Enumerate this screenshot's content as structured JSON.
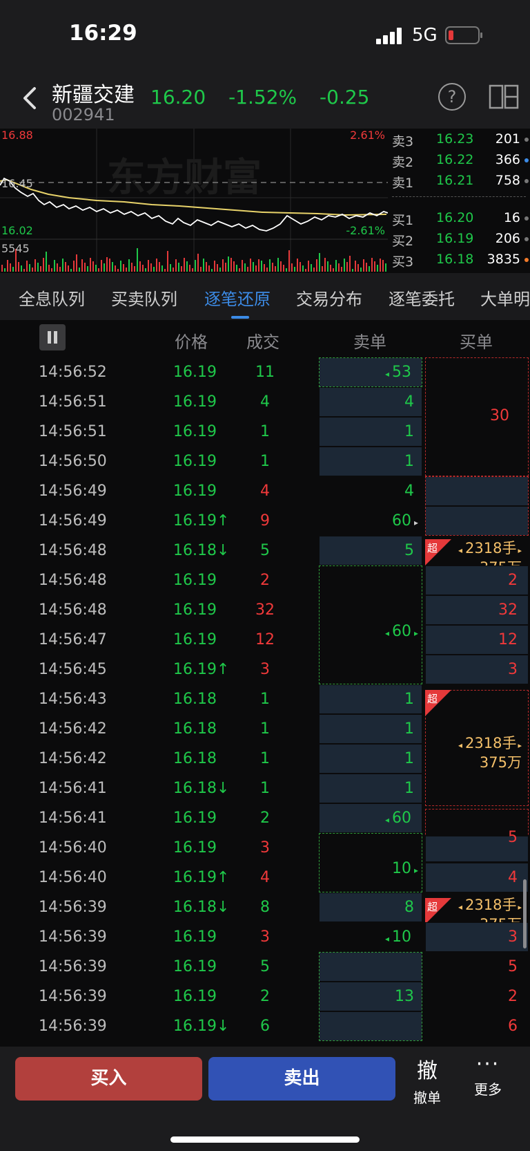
{
  "status": {
    "time": "16:29",
    "network": "5G"
  },
  "header": {
    "name": "新疆交建",
    "code": "002941",
    "price": "16.20",
    "pct": "-1.52%",
    "change": "-0.25",
    "help": "?"
  },
  "chart": {
    "high": "16.88",
    "high_pct": "2.61%",
    "mid": "16.45",
    "low": "16.02",
    "low_pct": "-2.61%",
    "volume": "5545",
    "watermark": "东方财富"
  },
  "book": {
    "sells": [
      {
        "label": "卖3",
        "price": "16.23",
        "vol": "201",
        "dot": "#777777"
      },
      {
        "label": "卖2",
        "price": "16.22",
        "vol": "366",
        "dot": "#3c8be6"
      },
      {
        "label": "卖1",
        "price": "16.21",
        "vol": "758",
        "dot": "#777777"
      }
    ],
    "buys": [
      {
        "label": "买1",
        "price": "16.20",
        "vol": "16",
        "dot": "#777777"
      },
      {
        "label": "买2",
        "price": "16.19",
        "vol": "206",
        "dot": "#777777"
      },
      {
        "label": "买3",
        "price": "16.18",
        "vol": "3835",
        "dot": "#f27a2a"
      }
    ]
  },
  "tabs": [
    "全息队列",
    "买卖队列",
    "逐笔还原",
    "交易分布",
    "逐笔委托",
    "大单明"
  ],
  "columns": {
    "price": "价格",
    "volume": "成交",
    "sell": "卖单",
    "buy": "买单"
  },
  "trades": [
    {
      "time": "14:56:52",
      "price": "16.19",
      "vol": "11",
      "vc": "green"
    },
    {
      "time": "14:56:51",
      "price": "16.19",
      "vol": "4",
      "vc": "green"
    },
    {
      "time": "14:56:51",
      "price": "16.19",
      "vol": "1",
      "vc": "green"
    },
    {
      "time": "14:56:50",
      "price": "16.19",
      "vol": "1",
      "vc": "green"
    },
    {
      "time": "14:56:49",
      "price": "16.19",
      "vol": "4",
      "vc": "red"
    },
    {
      "time": "14:56:49",
      "price": "16.19↑",
      "vol": "9",
      "vc": "red"
    },
    {
      "time": "14:56:48",
      "price": "16.18↓",
      "vol": "5",
      "vc": "green"
    },
    {
      "time": "14:56:48",
      "price": "16.19",
      "vol": "2",
      "vc": "red"
    },
    {
      "time": "14:56:48",
      "price": "16.19",
      "vol": "32",
      "vc": "red"
    },
    {
      "time": "14:56:47",
      "price": "16.19",
      "vol": "12",
      "vc": "red"
    },
    {
      "time": "14:56:45",
      "price": "16.19↑",
      "vol": "3",
      "vc": "red"
    },
    {
      "time": "14:56:43",
      "price": "16.18",
      "vol": "1",
      "vc": "green"
    },
    {
      "time": "14:56:42",
      "price": "16.18",
      "vol": "1",
      "vc": "green"
    },
    {
      "time": "14:56:42",
      "price": "16.18",
      "vol": "1",
      "vc": "green"
    },
    {
      "time": "14:56:41",
      "price": "16.18↓",
      "vol": "1",
      "vc": "green"
    },
    {
      "time": "14:56:41",
      "price": "16.19",
      "vol": "2",
      "vc": "green"
    },
    {
      "time": "14:56:40",
      "price": "16.19",
      "vol": "3",
      "vc": "red"
    },
    {
      "time": "14:56:40",
      "price": "16.19↑",
      "vol": "4",
      "vc": "red"
    },
    {
      "time": "14:56:39",
      "price": "16.18↓",
      "vol": "8",
      "vc": "green"
    },
    {
      "time": "14:56:39",
      "price": "16.19",
      "vol": "3",
      "vc": "red"
    },
    {
      "time": "14:56:39",
      "price": "16.19",
      "vol": "5",
      "vc": "green"
    },
    {
      "time": "14:56:39",
      "price": "16.19",
      "vol": "2",
      "vc": "green"
    },
    {
      "time": "14:56:39",
      "price": "16.19↓",
      "vol": "6",
      "vc": "green"
    }
  ],
  "sell_orders": {
    "r0": "53",
    "r1": "4",
    "r2": "1",
    "r3": "1",
    "r4": "4",
    "r5": "60",
    "r6": "5",
    "g7": "60",
    "r11": "1",
    "r12": "1",
    "r13": "1",
    "r14": "1",
    "r15": "60",
    "g16": "10",
    "r18": "8",
    "r19": "10",
    "g20": "13"
  },
  "buy_orders": {
    "g0": "30",
    "r7": "2",
    "r8": "32",
    "r9": "12",
    "r10": "3",
    "g16": "5",
    "r17": "4",
    "r19": "3",
    "r20": "5",
    "r21": "2",
    "r22": "6"
  },
  "big_order": {
    "badge": "超",
    "lots": "2318手",
    "amount": "375万"
  },
  "bottom": {
    "buy": "买入",
    "sell": "卖出",
    "cancel_big": "撤",
    "cancel": "撤单",
    "more": "更多"
  }
}
